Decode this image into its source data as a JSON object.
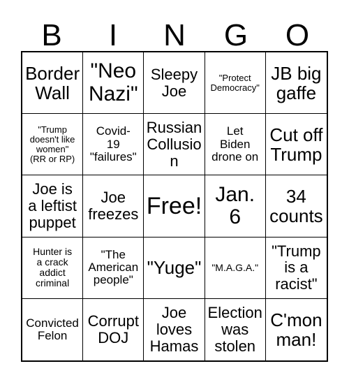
{
  "header": {
    "letters": [
      "B",
      "I",
      "N",
      "G",
      "O"
    ]
  },
  "grid": {
    "rows": 5,
    "columns": 5,
    "free_space_index": 12,
    "cells": [
      {
        "text": "Border\nWall",
        "size": "lg"
      },
      {
        "text": "\"Neo\nNazi\"",
        "size": "xl"
      },
      {
        "text": "Sleepy\nJoe",
        "size": "md"
      },
      {
        "text": "\"Protect\nDemocracy\"",
        "size": "xxs"
      },
      {
        "text": "JB big\ngaffe",
        "size": "lg"
      },
      {
        "text": "\"Trump\ndoesn't like\nwomen\"\n(RR or RP)",
        "size": "xxs"
      },
      {
        "text": "Covid-\n19\n\"failures\"",
        "size": "sm"
      },
      {
        "text": "Russian\nCollusion",
        "size": "md"
      },
      {
        "text": "Let\nBiden\ndrone on",
        "size": "sm"
      },
      {
        "text": "Cut off\nTrump",
        "size": "lg"
      },
      {
        "text": "Joe is\na leftist\npuppet",
        "size": "md"
      },
      {
        "text": "Joe\nfreezes",
        "size": "md"
      },
      {
        "text": "Free!",
        "size": "xxl"
      },
      {
        "text": "Jan.\n6",
        "size": "xl"
      },
      {
        "text": "34\ncounts",
        "size": "lg"
      },
      {
        "text": "Hunter is\na crack\naddict\ncriminal",
        "size": "xs"
      },
      {
        "text": "\"The\nAmerican\npeople\"",
        "size": "sm"
      },
      {
        "text": "\"Yuge\"",
        "size": "lg"
      },
      {
        "text": "\"M.A.G.A.\"",
        "size": "xs"
      },
      {
        "text": "\"Trump\nis a\nracist\"",
        "size": "md"
      },
      {
        "text": "Convicted\nFelon",
        "size": "sm"
      },
      {
        "text": "Corrupt\nDOJ",
        "size": "md"
      },
      {
        "text": "Joe\nloves\nHamas",
        "size": "md"
      },
      {
        "text": "Election\nwas\nstolen",
        "size": "md"
      },
      {
        "text": "C'mon\nman!",
        "size": "lg"
      }
    ]
  },
  "colors": {
    "background": "#ffffff",
    "text": "#000000",
    "border": "#000000"
  }
}
